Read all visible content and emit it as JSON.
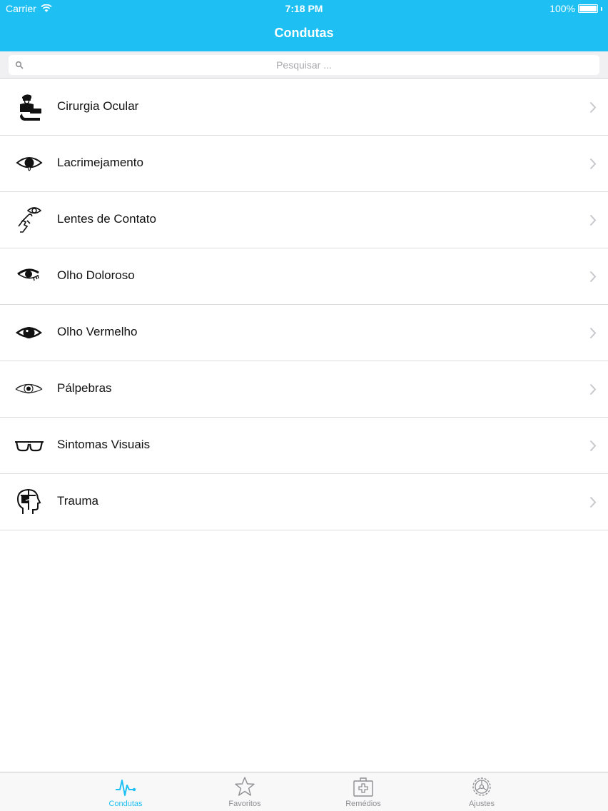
{
  "status_bar": {
    "carrier": "Carrier",
    "time": "7:18 PM",
    "battery": "100%"
  },
  "nav": {
    "title": "Condutas"
  },
  "search": {
    "placeholder": "Pesquisar ..."
  },
  "items": [
    {
      "label": "Cirurgia Ocular",
      "icon": "surgeon-icon"
    },
    {
      "label": "Lacrimejamento",
      "icon": "tearing-eye-icon"
    },
    {
      "label": "Lentes de Contato",
      "icon": "contact-lens-icon"
    },
    {
      "label": "Olho Doloroso",
      "icon": "painful-eye-icon"
    },
    {
      "label": "Olho Vermelho",
      "icon": "red-eye-icon"
    },
    {
      "label": "Pálpebras",
      "icon": "eyelid-icon"
    },
    {
      "label": "Sintomas Visuais",
      "icon": "glasses-icon"
    },
    {
      "label": "Trauma",
      "icon": "head-trauma-icon"
    }
  ],
  "tabs": [
    {
      "label": "Condutas",
      "icon": "pulse-icon",
      "active": true
    },
    {
      "label": "Favoritos",
      "icon": "star-icon",
      "active": false
    },
    {
      "label": "Remédios",
      "icon": "first-aid-kit-icon",
      "active": false
    },
    {
      "label": "Ajustes",
      "icon": "gear-icon",
      "active": false
    }
  ],
  "colors": {
    "accent": "#1ec0f4",
    "separator": "#dcdce0",
    "inactive_tab": "#8e8e93"
  }
}
